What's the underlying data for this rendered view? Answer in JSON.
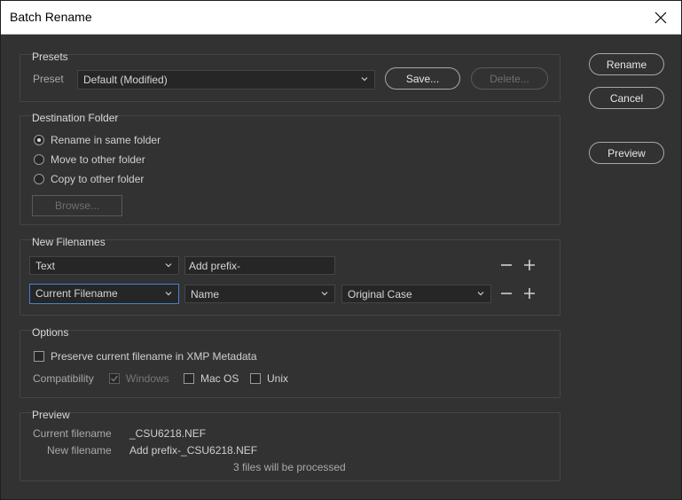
{
  "window": {
    "title": "Batch Rename"
  },
  "presets": {
    "legend": "Presets",
    "preset_label": "Preset",
    "preset_value": "Default (Modified)",
    "save_label": "Save...",
    "delete_label": "Delete..."
  },
  "actions": {
    "rename": "Rename",
    "cancel": "Cancel",
    "preview": "Preview"
  },
  "destination": {
    "legend": "Destination Folder",
    "options": [
      "Rename in same folder",
      "Move to other folder",
      "Copy to other folder"
    ],
    "selected_index": 0,
    "browse_label": "Browse..."
  },
  "new_filenames": {
    "legend": "New Filenames",
    "row1": {
      "type": "Text",
      "value": "Add prefix-"
    },
    "row2": {
      "type": "Current Filename",
      "part": "Name",
      "case": "Original Case"
    }
  },
  "options": {
    "legend": "Options",
    "preserve_label": "Preserve current filename in XMP Metadata",
    "compat_label": "Compatibility",
    "windows_label": "Windows",
    "macos_label": "Mac OS",
    "unix_label": "Unix",
    "windows_checked": true,
    "macos_checked": false,
    "unix_checked": false,
    "preserve_checked": false
  },
  "preview": {
    "legend": "Preview",
    "current_label": "Current filename",
    "current_value": "_CSU6218.NEF",
    "new_label": "New filename",
    "new_value": "Add prefix-_CSU6218.NEF",
    "status": "3 files will be processed"
  }
}
